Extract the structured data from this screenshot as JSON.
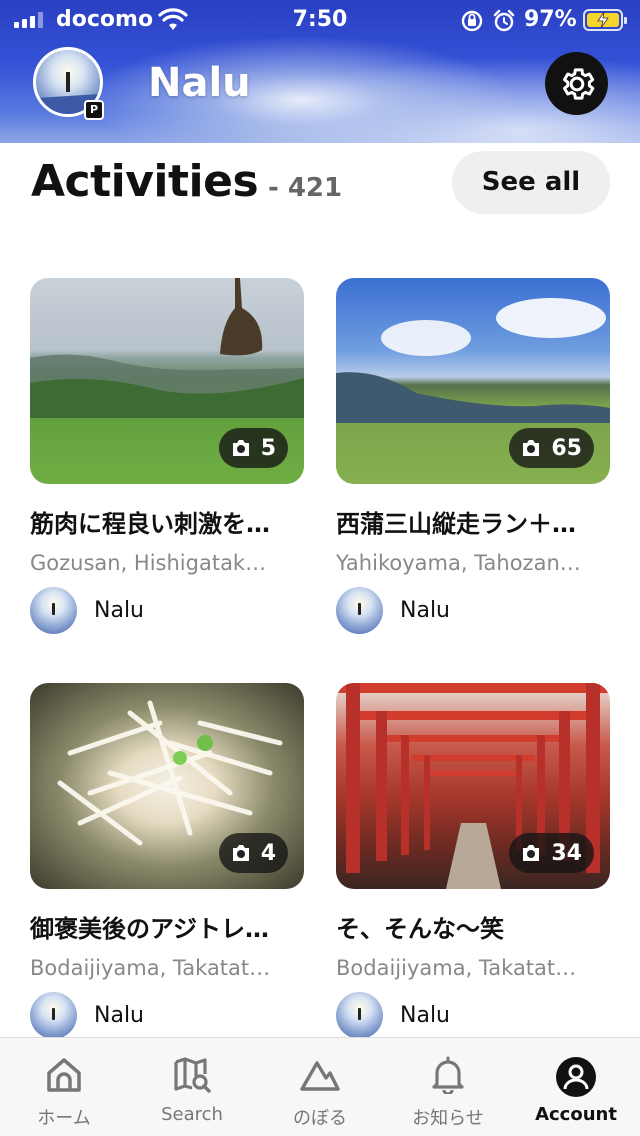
{
  "status_bar": {
    "carrier": "docomo",
    "time": "7:50",
    "battery_percent": "97%",
    "icons": [
      "signal-icon",
      "wifi-icon",
      "orientation-lock-icon",
      "alarm-icon",
      "battery-charging-icon"
    ]
  },
  "profile": {
    "name": "Nalu",
    "badge": "P"
  },
  "section": {
    "title": "Activities",
    "count": "- 421",
    "see_all_label": "See all"
  },
  "activities": [
    {
      "title": "筋肉に程良い刺激を…",
      "mountains": "Gozusan, Hishigatak…",
      "photo_count": "5",
      "author": "Nalu"
    },
    {
      "title": "西蒲三山縦走ラン＋…",
      "mountains": "Yahikoyama, Tahozan…",
      "photo_count": "65",
      "author": "Nalu"
    },
    {
      "title": "御褒美後のアジトレ…",
      "mountains": "Bodaijiyama, Takatat…",
      "photo_count": "4",
      "author": "Nalu"
    },
    {
      "title": "そ、そんな〜笑",
      "mountains": "Bodaijiyama, Takatat…",
      "photo_count": "34",
      "author": "Nalu"
    }
  ],
  "tabs": [
    {
      "label": "ホーム",
      "icon": "home-icon"
    },
    {
      "label": "Search",
      "icon": "map-search-icon"
    },
    {
      "label": "のぼる",
      "icon": "mountain-icon"
    },
    {
      "label": "お知らせ",
      "icon": "bell-icon"
    },
    {
      "label": "Account",
      "icon": "account-icon",
      "active": true
    }
  ],
  "colors": {
    "header_blue": "#3452d6",
    "text_primary": "#111111",
    "text_secondary": "#888888",
    "tab_inactive": "#777777",
    "battery_yellow": "#f5d52b"
  }
}
